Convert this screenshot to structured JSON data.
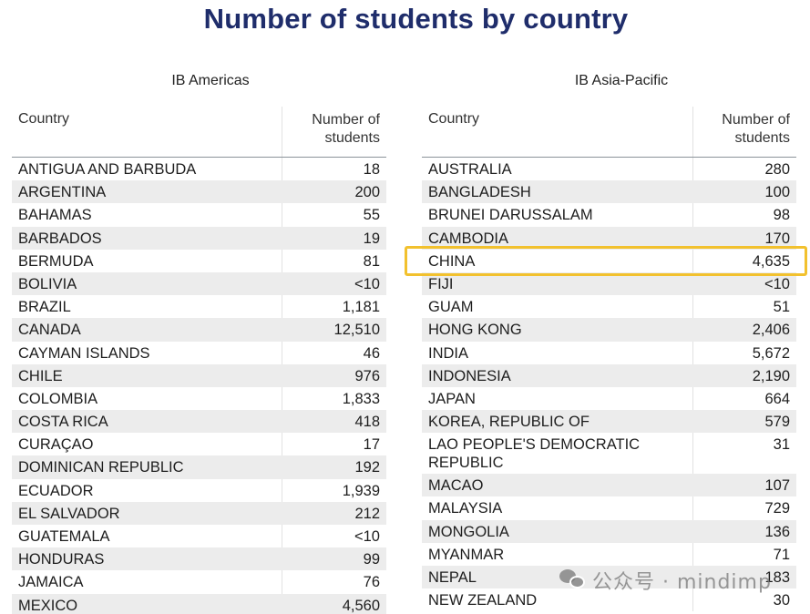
{
  "title": "Number of students by country",
  "highlight_color": "#f2c12e",
  "title_color": "#1f2d6b",
  "watermark": {
    "icon": "wechat-icon",
    "text": "公众号 · mindimp"
  },
  "tables": [
    {
      "region": "IB Americas",
      "headers": {
        "country": "Country",
        "count_line1": "Number of",
        "count_line2": "students"
      },
      "rows": [
        {
          "country": "ANTIGUA AND BARBUDA",
          "students": "18"
        },
        {
          "country": "ARGENTINA",
          "students": "200"
        },
        {
          "country": "BAHAMAS",
          "students": "55"
        },
        {
          "country": "BARBADOS",
          "students": "19"
        },
        {
          "country": "BERMUDA",
          "students": "81"
        },
        {
          "country": "BOLIVIA",
          "students": "<10"
        },
        {
          "country": "BRAZIL",
          "students": "1,181"
        },
        {
          "country": "CANADA",
          "students": "12,510"
        },
        {
          "country": "CAYMAN ISLANDS",
          "students": "46"
        },
        {
          "country": "CHILE",
          "students": "976"
        },
        {
          "country": "COLOMBIA",
          "students": "1,833"
        },
        {
          "country": "COSTA RICA",
          "students": "418"
        },
        {
          "country": "CURAÇAO",
          "students": "17"
        },
        {
          "country": "DOMINICAN REPUBLIC",
          "students": "192"
        },
        {
          "country": "ECUADOR",
          "students": "1,939"
        },
        {
          "country": "EL SALVADOR",
          "students": "212"
        },
        {
          "country": "GUATEMALA",
          "students": "<10"
        },
        {
          "country": "HONDURAS",
          "students": "99"
        },
        {
          "country": "JAMAICA",
          "students": "76"
        },
        {
          "country": "MEXICO",
          "students": "4,560"
        }
      ]
    },
    {
      "region": "IB Asia-Pacific",
      "headers": {
        "country": "Country",
        "count_line1": "Number of",
        "count_line2": "students"
      },
      "rows": [
        {
          "country": "AUSTRALIA",
          "students": "280"
        },
        {
          "country": "BANGLADESH",
          "students": "100"
        },
        {
          "country": "BRUNEI DARUSSALAM",
          "students": "98"
        },
        {
          "country": "CAMBODIA",
          "students": "170"
        },
        {
          "country": "CHINA",
          "students": "4,635",
          "highlighted": true
        },
        {
          "country": "FIJI",
          "students": "<10"
        },
        {
          "country": "GUAM",
          "students": "51"
        },
        {
          "country": "HONG KONG",
          "students": "2,406"
        },
        {
          "country": "INDIA",
          "students": "5,672"
        },
        {
          "country": "INDONESIA",
          "students": "2,190"
        },
        {
          "country": "JAPAN",
          "students": "664"
        },
        {
          "country": "KOREA, REPUBLIC OF",
          "students": "579"
        },
        {
          "country": "LAO PEOPLE'S DEMOCRATIC REPUBLIC",
          "students": "31"
        },
        {
          "country": "MACAO",
          "students": "107"
        },
        {
          "country": "MALAYSIA",
          "students": "729"
        },
        {
          "country": "MONGOLIA",
          "students": "136"
        },
        {
          "country": "MYANMAR",
          "students": "71"
        },
        {
          "country": "NEPAL",
          "students": "183"
        },
        {
          "country": "NEW ZEALAND",
          "students": "30"
        }
      ]
    }
  ]
}
